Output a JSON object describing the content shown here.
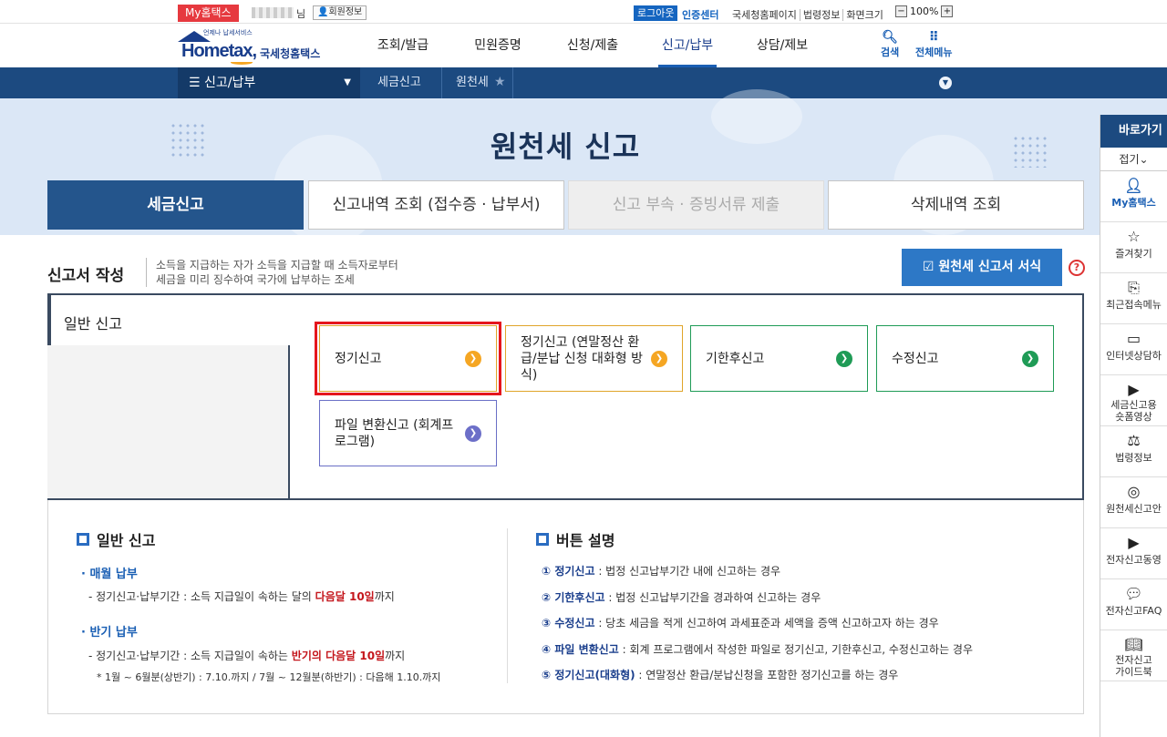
{
  "topbar": {
    "my_hometax": "My홈택스",
    "user_suffix": "님",
    "member_info": "회원정보",
    "logout": "로그아웃",
    "cert_center": "인증센터",
    "links": [
      "국세청홈페이지",
      "법령정보",
      "화면크기"
    ],
    "zoom_minus": "−",
    "zoom_level": "100%",
    "zoom_plus": "+"
  },
  "header": {
    "logo_tagline": "언제나 납세서비스",
    "logo_en": "Hometax,",
    "logo_ko": "국세청홈택스",
    "gnb": [
      "조회/발급",
      "민원증명",
      "신청/제출",
      "신고/납부",
      "상담/제보"
    ],
    "gnb_active_index": 3,
    "search": "검색",
    "all_menu": "전체메뉴"
  },
  "navbar": {
    "menu": "신고/납부",
    "crumbs": [
      "세금신고",
      "원천세"
    ]
  },
  "page": {
    "title": "원천세 신고",
    "tabs": [
      "세금신고",
      "신고내역 조회 (접수증 · 납부서)",
      "신고 부속 · 증빙서류 제출",
      "삭제내역 조회"
    ]
  },
  "section": {
    "title": "신고서 작성",
    "desc_1": "소득을 지급하는 자가 소득을 지급할 때 소득자로부터",
    "desc_2": "세금을 미리 징수하여 국가에 납부하는 조세",
    "form_button": "원천세 신고서 서식",
    "help": "?"
  },
  "filing": {
    "tab": "일반 신고",
    "options": [
      {
        "label": "정기신고"
      },
      {
        "label": "정기신고 (연말정산 환급/분납 신청 대화형 방식)"
      },
      {
        "label": "기한후신고"
      },
      {
        "label": "수정신고"
      },
      {
        "label": "파일 변환신고 (회계프로그램)"
      }
    ]
  },
  "info": {
    "left_title": "일반 신고",
    "monthly_title": "· 매월 납부",
    "monthly_line_pre": "- 정기신고·납부기간 : 소득 지급일이 속하는 달의",
    "monthly_line_red": "다음달 10일",
    "monthly_line_post": "까지",
    "half_title": "· 반기 납부",
    "half_line_pre": "- 정기신고·납부기간 : 소득 지급일이 속하는",
    "half_line_red": "반기의 다음달 10일",
    "half_line_post": "까지",
    "half_note": "* 1월 ~ 6월분(상반기) : 7.10.까지 / 7월 ~ 12월분(하반기) : 다음해 1.10.까지",
    "right_title": "버튼 설명",
    "buttons": [
      {
        "name": "① 정기신고",
        "desc": " : 법정 신고납부기간 내에 신고하는 경우"
      },
      {
        "name": "② 기한후신고",
        "desc": " : 법정 신고납부기간을 경과하여 신고하는 경우"
      },
      {
        "name": "③ 수정신고",
        "desc": " : 당초 세금을 적게 신고하여 과세표준과 세액을 증액 신고하고자 하는 경우"
      },
      {
        "name": "④ 파일 변환신고",
        "desc": " : 회계 프로그램에서 작성한 파일로 정기신고, 기한후신고, 수정신고하는 경우"
      },
      {
        "name": "⑤ 정기신고(대화형)",
        "desc": " : 연말정산 환급/분납신청을 포함한 정기신고를 하는 경우"
      }
    ]
  },
  "quick": {
    "head": "바로가기",
    "fold": "접기⌄",
    "items": [
      {
        "label": "My홈택스",
        "icon": "person-icon"
      },
      {
        "label": "즐겨찾기",
        "icon": "star-icon"
      },
      {
        "label": "최근접속메뉴",
        "icon": "recent-icon"
      },
      {
        "label": "인터넷상담하",
        "icon": "chat-monitor-icon"
      },
      {
        "label": "세금신고용\n숏폼영상",
        "icon": "video-icon"
      },
      {
        "label": "법령정보",
        "icon": "gavel-icon"
      },
      {
        "label": "원천세신고안",
        "icon": "coins-icon"
      },
      {
        "label": "전자신고동영",
        "icon": "play-icon"
      },
      {
        "label": "전자신고FAQ",
        "icon": "speech-icon"
      },
      {
        "label": "전자신고\n가이드북",
        "icon": "book-icon"
      }
    ]
  }
}
